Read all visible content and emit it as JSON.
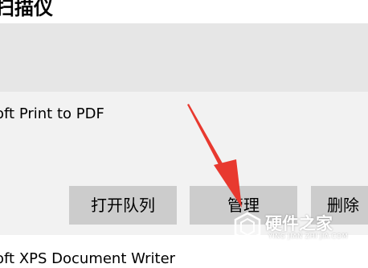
{
  "section": {
    "title": "扫描仪"
  },
  "printers": [
    {
      "name": "oft Print to PDF",
      "buttons": {
        "open_queue": "打开队列",
        "manage": "管理",
        "remove": "删除"
      }
    },
    {
      "name": "oft XPS Document Writer"
    }
  ],
  "watermark": {
    "title": "硬件之家",
    "subtitle": "YING JIAN ZHI JIA.COM"
  },
  "annotation": {
    "type": "red-arrow",
    "color": "#e8392f",
    "points_to": "manage-button"
  }
}
